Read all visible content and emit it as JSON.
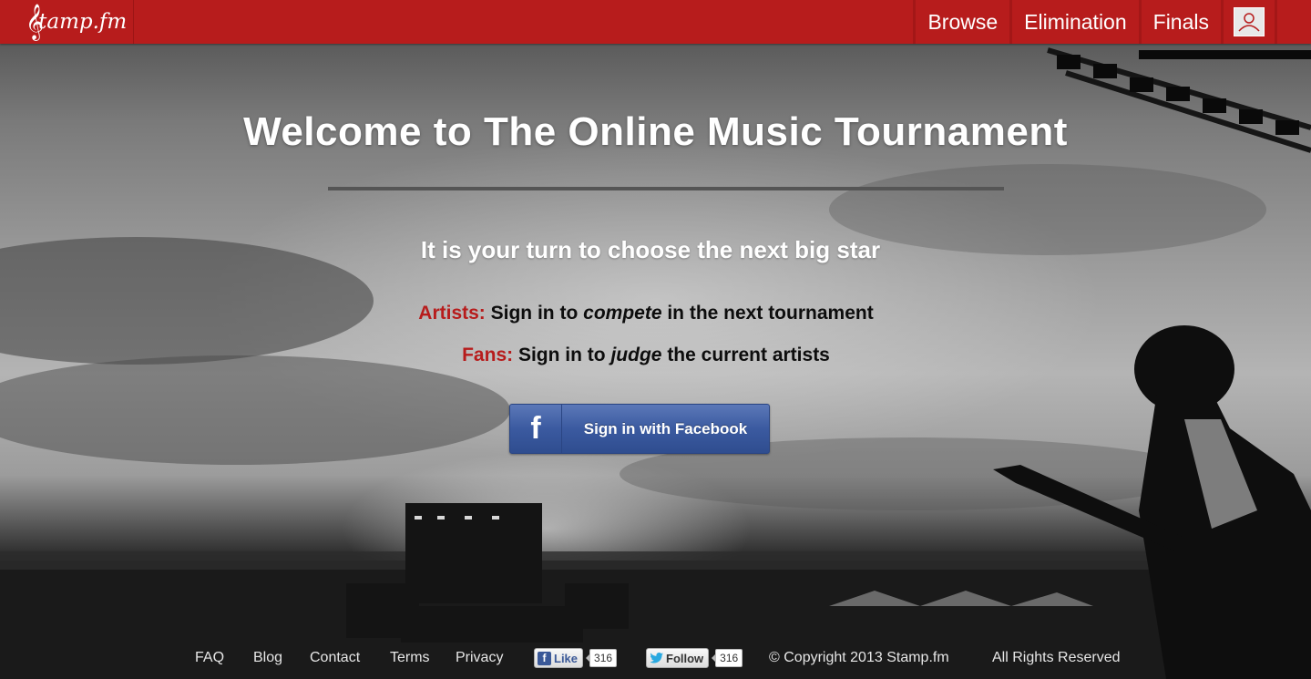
{
  "navbar": {
    "logo_clef": "𝄞",
    "logo_text": "tamp.fm",
    "items": [
      {
        "label": "Browse"
      },
      {
        "label": "Elimination"
      },
      {
        "label": "Finals"
      }
    ]
  },
  "hero": {
    "title": "Welcome to The Online Music Tournament",
    "subtitle": "It is your turn to choose the next big star",
    "artists_label": "Artists:",
    "artists_pre": "Sign in to",
    "artists_em": "compete",
    "artists_post": "in the next tournament",
    "fans_label": "Fans:",
    "fans_pre": "Sign in to",
    "fans_em": "judge",
    "fans_post": "the current artists",
    "facebook_button_icon": "f",
    "facebook_button_label": "Sign in with Facebook"
  },
  "footer": {
    "links": [
      "FAQ",
      "Blog",
      "Contact",
      "Terms",
      "Privacy"
    ],
    "like_label": "Like",
    "like_count": "316",
    "follow_label": "Follow",
    "follow_count": "316",
    "copyright": "© Copyright 2013 Stamp.fm",
    "rights": "All Rights Reserved"
  },
  "colors": {
    "brand_red": "#b71c1c",
    "facebook_blue": "#3b5aa0"
  }
}
